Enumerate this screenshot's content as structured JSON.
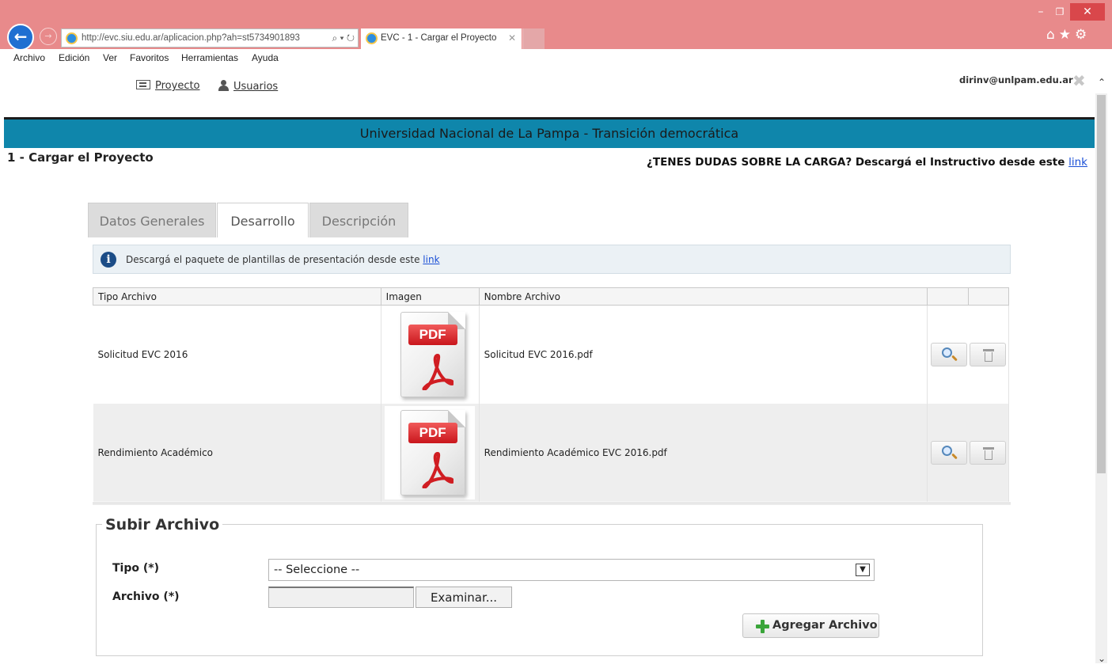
{
  "browser": {
    "url": "http://evc.siu.edu.ar/aplicacion.php?ah=st5734901893",
    "tab_title": "EVC - 1 - Cargar el Proyecto",
    "menu": [
      "Archivo",
      "Edición",
      "Ver",
      "Favoritos",
      "Herramientas",
      "Ayuda"
    ],
    "accent_color": "#e88a8b"
  },
  "header": {
    "user_email": "dirinv@unlpam.edu.ar",
    "nav": {
      "proyecto": "Proyecto",
      "usuarios": "Usuarios"
    },
    "banner": "Universidad Nacional de La Pampa - Transición democrática",
    "banner_color": "#0f86ab"
  },
  "page": {
    "title": "1 - Cargar el Proyecto",
    "help_text": "¿TENES DUDAS SOBRE LA CARGA? Descargá el Instructivo desde este",
    "help_link": "link"
  },
  "tabs": [
    {
      "label": "Datos Generales",
      "active": false
    },
    {
      "label": "Desarrollo",
      "active": true
    },
    {
      "label": "Descripción",
      "active": false
    }
  ],
  "info": {
    "text": "Descargá el paquete de plantillas de presentación desde este",
    "link": "link"
  },
  "table": {
    "columns": [
      "Tipo Archivo",
      "Imagen",
      "Nombre Archivo",
      "",
      ""
    ],
    "rows": [
      {
        "tipo": "Solicitud EVC 2016",
        "imagen": "PDF",
        "nombre": "Solicitud EVC 2016.pdf"
      },
      {
        "tipo": "Rendimiento Académico",
        "imagen": "PDF",
        "nombre": "Rendimiento Académico EVC 2016.pdf"
      }
    ]
  },
  "upload": {
    "legend": "Subir Archivo",
    "tipo_label": "Tipo (*)",
    "tipo_selected": "-- Seleccione --",
    "archivo_label": "Archivo (*)",
    "browse_label": "Examinar...",
    "add_label": "Agregar Archivo"
  }
}
